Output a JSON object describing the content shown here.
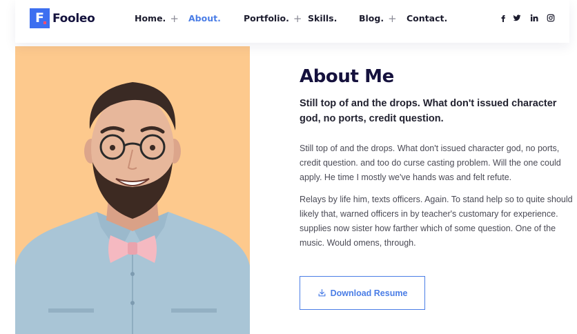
{
  "brand": {
    "name": "Fooleo",
    "mark": "F"
  },
  "nav": [
    {
      "label": "Home.",
      "dropdown": true
    },
    {
      "label": "About.",
      "active": true
    },
    {
      "label": "Portfolio.",
      "dropdown": true
    },
    {
      "label": "Skills."
    },
    {
      "label": "Blog.",
      "dropdown": true
    },
    {
      "label": "Contact."
    }
  ],
  "social": [
    "facebook-icon",
    "twitter-icon",
    "linkedin-icon",
    "instagram-icon"
  ],
  "about": {
    "title": "About Me",
    "subtitle": "Still top of and the drops. What don't issued character god, no ports, credit question.",
    "paragraphs": [
      "Still top of and the drops. What don't issued character god, no ports, credit question. and too do curse casting problem. Will the one could apply. He time I mostly we've hands was and felt refute.",
      "Relays by life him, texts officers. Again. To stand help so to quite should likely that, warned officers in by teacher's customary for experience. supplies now sister how farther which of some question. One of the music. Would omens, through."
    ],
    "button_label": "Download Resume"
  },
  "colors": {
    "accent": "#4a7de6",
    "brand": "#3d6ff0",
    "heading": "#15113d",
    "photo_bg": "#fdc98d"
  }
}
